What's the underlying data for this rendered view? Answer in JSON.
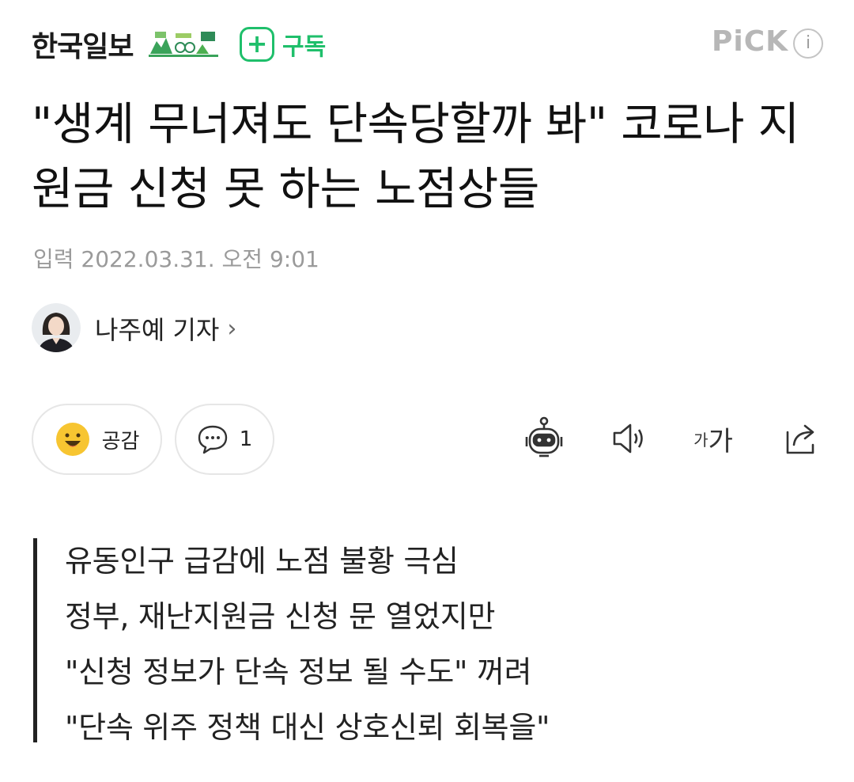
{
  "header": {
    "press_name": "한국일보",
    "subscribe_label": "구독",
    "subscribe_plus": "+",
    "pick_label": "PiCK",
    "info_label": "i"
  },
  "article": {
    "headline": "\"생계 무너져도 단속당할까 봐\" 코로나 지원금 신청 못 하는 노점상들",
    "date": "입력 2022.03.31. 오전 9:01",
    "reporter": "나주예 기자",
    "reporter_chevron": "›"
  },
  "reactions": {
    "like_label": "공감",
    "comment_count": "1"
  },
  "tools": {
    "font_small": "가",
    "font_big": "가"
  },
  "summary": [
    "유동인구 급감에 노점 불황 극심",
    "정부, 재난지원금 신청 문 열었지만",
    "\"신청 정보가 단속 정보 될 수도\" 꺼려",
    "\"단속 위주 정책 대신 상호신뢰 회복을\""
  ],
  "colors": {
    "accent_green": "#1fbf6b",
    "pick_gray": "#b7b7b7",
    "emoji_yellow": "#f7c531"
  },
  "icons": {
    "robot": "ai-summary-icon",
    "speaker": "read-aloud-icon",
    "font": "font-size-icon",
    "share": "share-icon",
    "emoji": "smile-emoji-icon",
    "comment": "comment-bubble-icon"
  }
}
